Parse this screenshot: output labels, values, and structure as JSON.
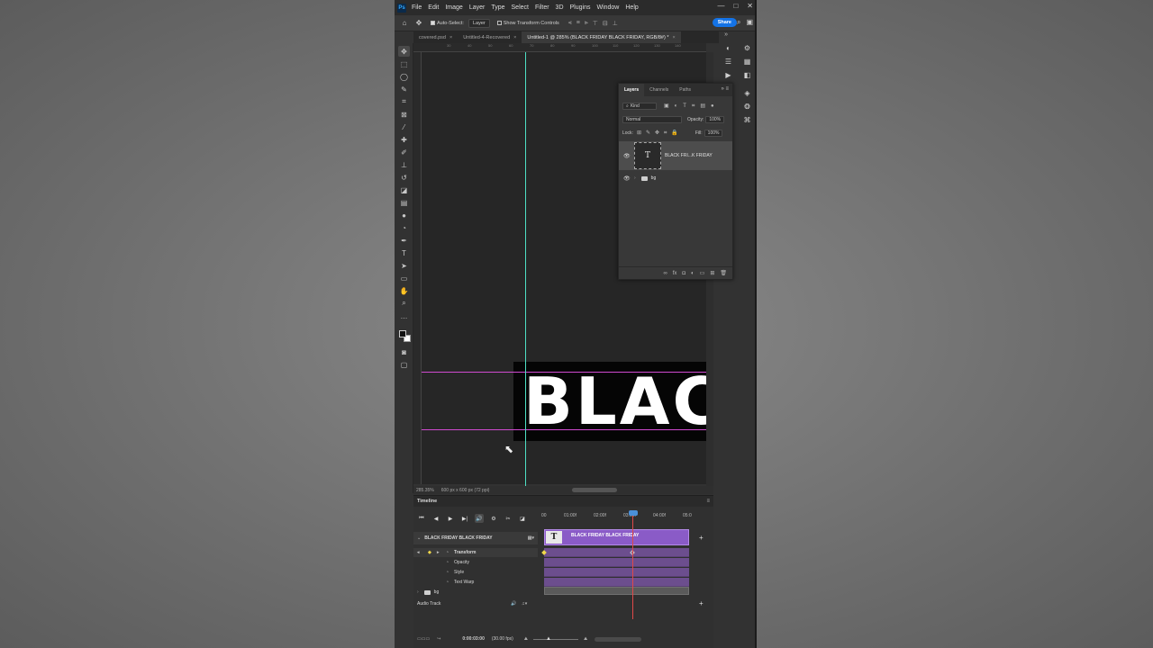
{
  "menu": {
    "logo": "Ps",
    "items": [
      "File",
      "Edit",
      "Image",
      "Layer",
      "Type",
      "Select",
      "Filter",
      "3D",
      "Plugins",
      "Window",
      "Help"
    ],
    "window_controls": [
      "—",
      "□",
      "✕"
    ]
  },
  "options_bar": {
    "auto_select_label": "Auto-Select:",
    "auto_select_value": "Layer",
    "show_transform_label": "Show Transform Controls",
    "share_label": "Share"
  },
  "tabs": [
    {
      "label": "covered.psd",
      "active": false
    },
    {
      "label": "Untitled-4-Recovered",
      "active": false
    },
    {
      "label": "Untitled-1 @ 285% (BLACK FRIDAY  BLACK FRIDAY, RGB/8#) *",
      "active": true
    }
  ],
  "canvas": {
    "text": "BLACK FRIDAY",
    "ruler_top": [
      "30",
      "40",
      "50",
      "60",
      "70",
      "80",
      "90",
      "100",
      "110",
      "120",
      "130",
      "140"
    ]
  },
  "status_bar": {
    "zoom": "285.35%",
    "doc_info": "600 px x 600 px (72 ppi)"
  },
  "layers_panel": {
    "tabs": [
      "Layers",
      "Channels",
      "Paths"
    ],
    "kind_label": "Kind",
    "blend_mode": "Normal",
    "opacity_label": "Opacity:",
    "opacity_value": "100%",
    "lock_label": "Lock:",
    "fill_label": "Fill:",
    "fill_value": "100%",
    "layers": [
      {
        "name": "BLACK FRI...K FRIDAY",
        "type": "text",
        "selected": true
      },
      {
        "name": "bg",
        "type": "group",
        "selected": false
      }
    ]
  },
  "timeline": {
    "title": "Timeline",
    "ruler_labels": [
      "00",
      "01:00f",
      "02:00f",
      "03:00f",
      "04:00f",
      "05:0"
    ],
    "track_name": "BLACK FRIDAY  BLACK FRIDAY",
    "clip_label": "BLACK FRIDAY  BLACK FRIDAY",
    "properties": [
      "Transform",
      "Opacity",
      "Style",
      "Text Warp"
    ],
    "bg_track": "bg",
    "audio_track": "Audio Track",
    "current_time": "0:00:03:00",
    "fps": "(30.00 fps)"
  }
}
